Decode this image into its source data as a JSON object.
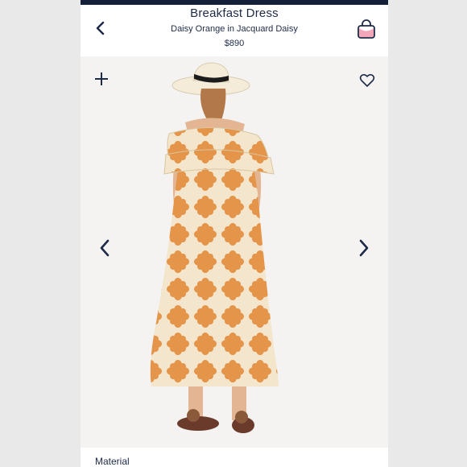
{
  "header": {
    "title": "Breakfast Dress",
    "subtitle": "Daisy Orange in Jacquard Daisy",
    "price": "$890"
  },
  "icons": {
    "back": "chevron-left-icon",
    "bag": "shopping-bag-icon",
    "add": "plus-icon",
    "favorite": "heart-icon",
    "prev": "chevron-left-icon",
    "next": "chevron-right-icon"
  },
  "product_image": {
    "description_colors": {
      "dress_base": "#f3e6cc",
      "dress_flower": "#e4954a",
      "hat": "#f4ecd8",
      "hat_band": "#1b1b1b",
      "sandals": "#6a3a2a"
    }
  },
  "details": {
    "section_label": "Material"
  },
  "colors": {
    "navy": "#1d2a48",
    "top_bar": "#14203a",
    "bag_accent": "#f2a6b8"
  }
}
